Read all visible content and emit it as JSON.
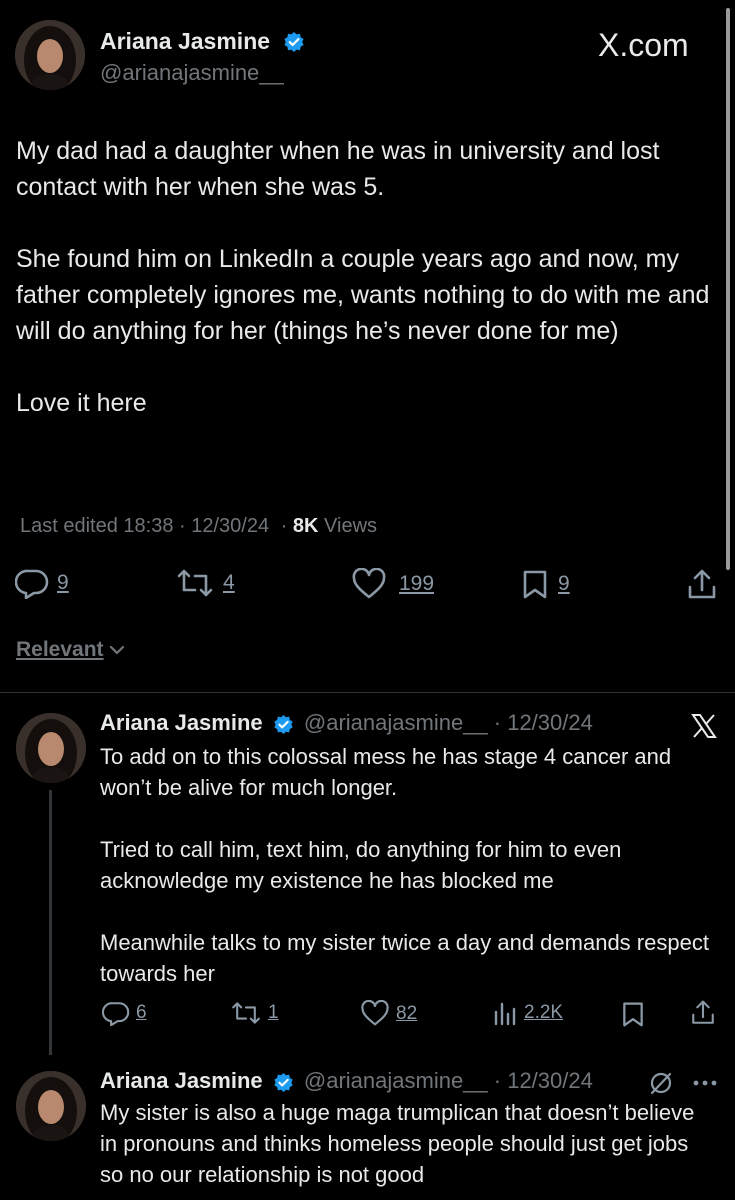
{
  "main_tweet": {
    "author_name": "Ariana Jasmine",
    "handle": "@arianajasmine__",
    "brand": "X.com",
    "text": "My dad had a daughter when he was in university and lost contact with her when she was 5.\n\nShe found him on LinkedIn a couple years ago and now, my father completely ignores me, wants nothing to do with me and will do anything for her (things he’s never done for me)\n\nLove it here",
    "edited_label": "Last edited 18:38 · 12/30/24",
    "views_sep": "·",
    "views_count": "8K",
    "views_label": "Views",
    "replies": "9",
    "reposts": "4",
    "likes": "199",
    "bookmarks": "9"
  },
  "sort": {
    "label": "Relevant"
  },
  "reply1": {
    "author_name": "Ariana Jasmine",
    "handle_date": "@arianajasmine__ · 12/30/24",
    "text": "To add on to this colossal mess he has stage 4 cancer and won’t be alive for much longer.\n\nTried to call him, text him, do anything for him to even acknowledge my existence he has blocked me\n\nMeanwhile talks to my sister twice a day and demands respect towards her",
    "replies": "6",
    "reposts": "1",
    "likes": "82",
    "views": "2.2K"
  },
  "reply2": {
    "author_name": "Ariana Jasmine",
    "handle_date": "@arianajasmine__ · 12/30/24",
    "text": "My sister is also a huge maga trumplican that doesn’t believe in pronouns and thinks homeless people should just get jobs so no our relationship is not good"
  },
  "colors": {
    "background": "#000000",
    "text": "#e7e9ea",
    "muted": "#71767b",
    "verified": "#1d9bf0"
  }
}
